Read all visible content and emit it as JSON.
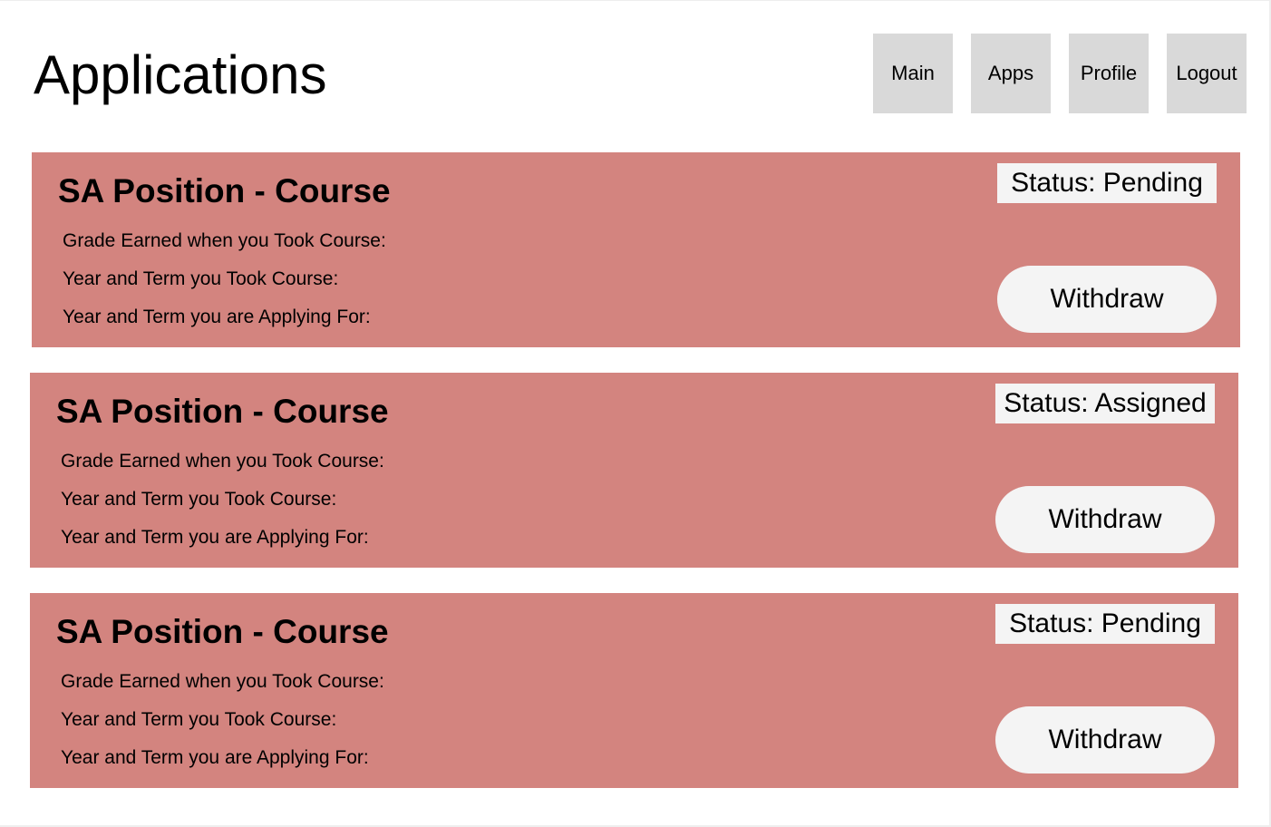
{
  "header": {
    "title": "Applications"
  },
  "nav": {
    "items": [
      {
        "label": "Main"
      },
      {
        "label": "Apps"
      },
      {
        "label": "Profile"
      },
      {
        "label": "Logout"
      }
    ]
  },
  "applications": [
    {
      "title": "SA Position - Course",
      "status": "Status: Pending",
      "grade_label": "Grade Earned when you Took Course:",
      "took_label": "Year and Term you Took Course:",
      "applying_label": "Year and Term you are Applying For:",
      "withdraw_label": "Withdraw"
    },
    {
      "title": "SA Position - Course",
      "status": "Status: Assigned",
      "grade_label": "Grade Earned when you Took Course:",
      "took_label": "Year and Term you Took Course:",
      "applying_label": "Year and Term you are Applying For:",
      "withdraw_label": "Withdraw"
    },
    {
      "title": "SA Position - Course",
      "status": "Status: Pending",
      "grade_label": "Grade Earned when you Took Course:",
      "took_label": "Year and Term you Took Course:",
      "applying_label": "Year and Term you are Applying For:",
      "withdraw_label": "Withdraw"
    }
  ],
  "colors": {
    "card_background": "#d3847f",
    "nav_button_background": "#d9d9d9",
    "pill_background": "#f4f4f4"
  }
}
